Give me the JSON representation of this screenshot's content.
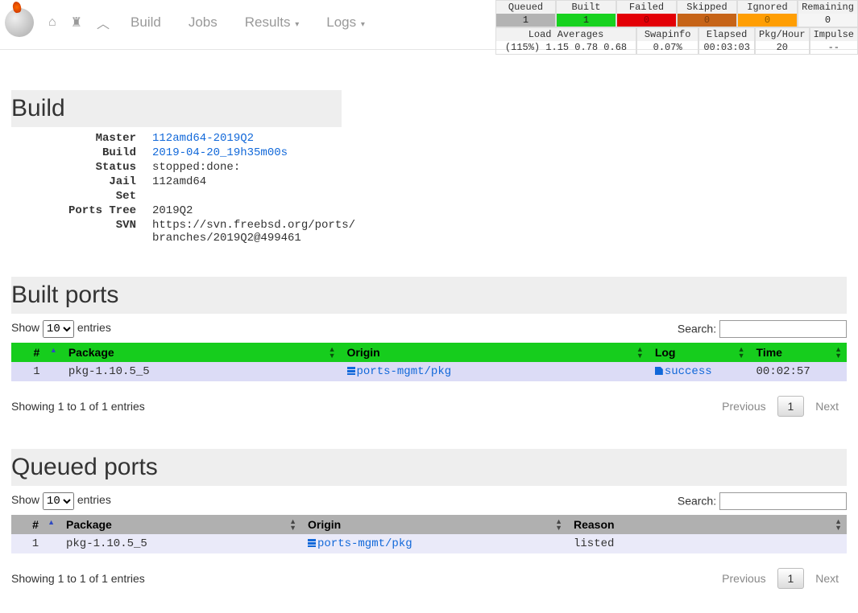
{
  "nav": {
    "build": "Build",
    "jobs": "Jobs",
    "results": "Results",
    "logs": "Logs"
  },
  "stats": {
    "headers": {
      "queued": "Queued",
      "built": "Built",
      "failed": "Failed",
      "skipped": "Skipped",
      "ignored": "Ignored",
      "remaining": "Remaining"
    },
    "values": {
      "queued": "1",
      "built": "1",
      "failed": "0",
      "skipped": "0",
      "ignored": "0",
      "remaining": "0"
    },
    "row2": {
      "load_lbl": "Load Averages",
      "load_val": "(115%) 1.15 0.78 0.68",
      "swap_lbl": "Swapinfo",
      "swap_val": "0.07%",
      "elapsed_lbl": "Elapsed",
      "elapsed_val": "00:03:03",
      "pkghr_lbl": "Pkg/Hour",
      "pkghr_val": "20",
      "impulse_lbl": "Impulse",
      "impulse_val": "--"
    }
  },
  "sections": {
    "build": "Build",
    "built_ports": "Built ports",
    "queued_ports": "Queued ports"
  },
  "build_info": {
    "master_k": "Master",
    "master_v": "112amd64-2019Q2",
    "build_k": "Build",
    "build_v": "2019-04-20_19h35m00s",
    "status_k": "Status",
    "status_v": "stopped:done:",
    "jail_k": "Jail",
    "jail_v": "112amd64",
    "set_k": "Set",
    "set_v": "",
    "ptree_k": "Ports Tree",
    "ptree_v": "2019Q2",
    "svn_k": "SVN",
    "svn_v": "https://svn.freebsd.org/ports/branches/2019Q2@499461"
  },
  "dt_common": {
    "show": "Show",
    "entries": "entries",
    "search": "Search:",
    "len_value": "10",
    "info": "Showing 1 to 1 of 1 entries",
    "prev": "Previous",
    "next": "Next",
    "page": "1"
  },
  "built_table": {
    "cols": {
      "idx": "#",
      "pkg": "Package",
      "origin": "Origin",
      "log": "Log",
      "time": "Time"
    },
    "row0": {
      "idx": "1",
      "pkg": "pkg-1.10.5_5",
      "origin": "ports-mgmt/pkg",
      "log": "success",
      "time": "00:02:57"
    }
  },
  "queued_table": {
    "cols": {
      "idx": "#",
      "pkg": "Package",
      "origin": "Origin",
      "reason": "Reason"
    },
    "row0": {
      "idx": "1",
      "pkg": "pkg-1.10.5_5",
      "origin": "ports-mgmt/pkg",
      "reason": "listed"
    }
  }
}
